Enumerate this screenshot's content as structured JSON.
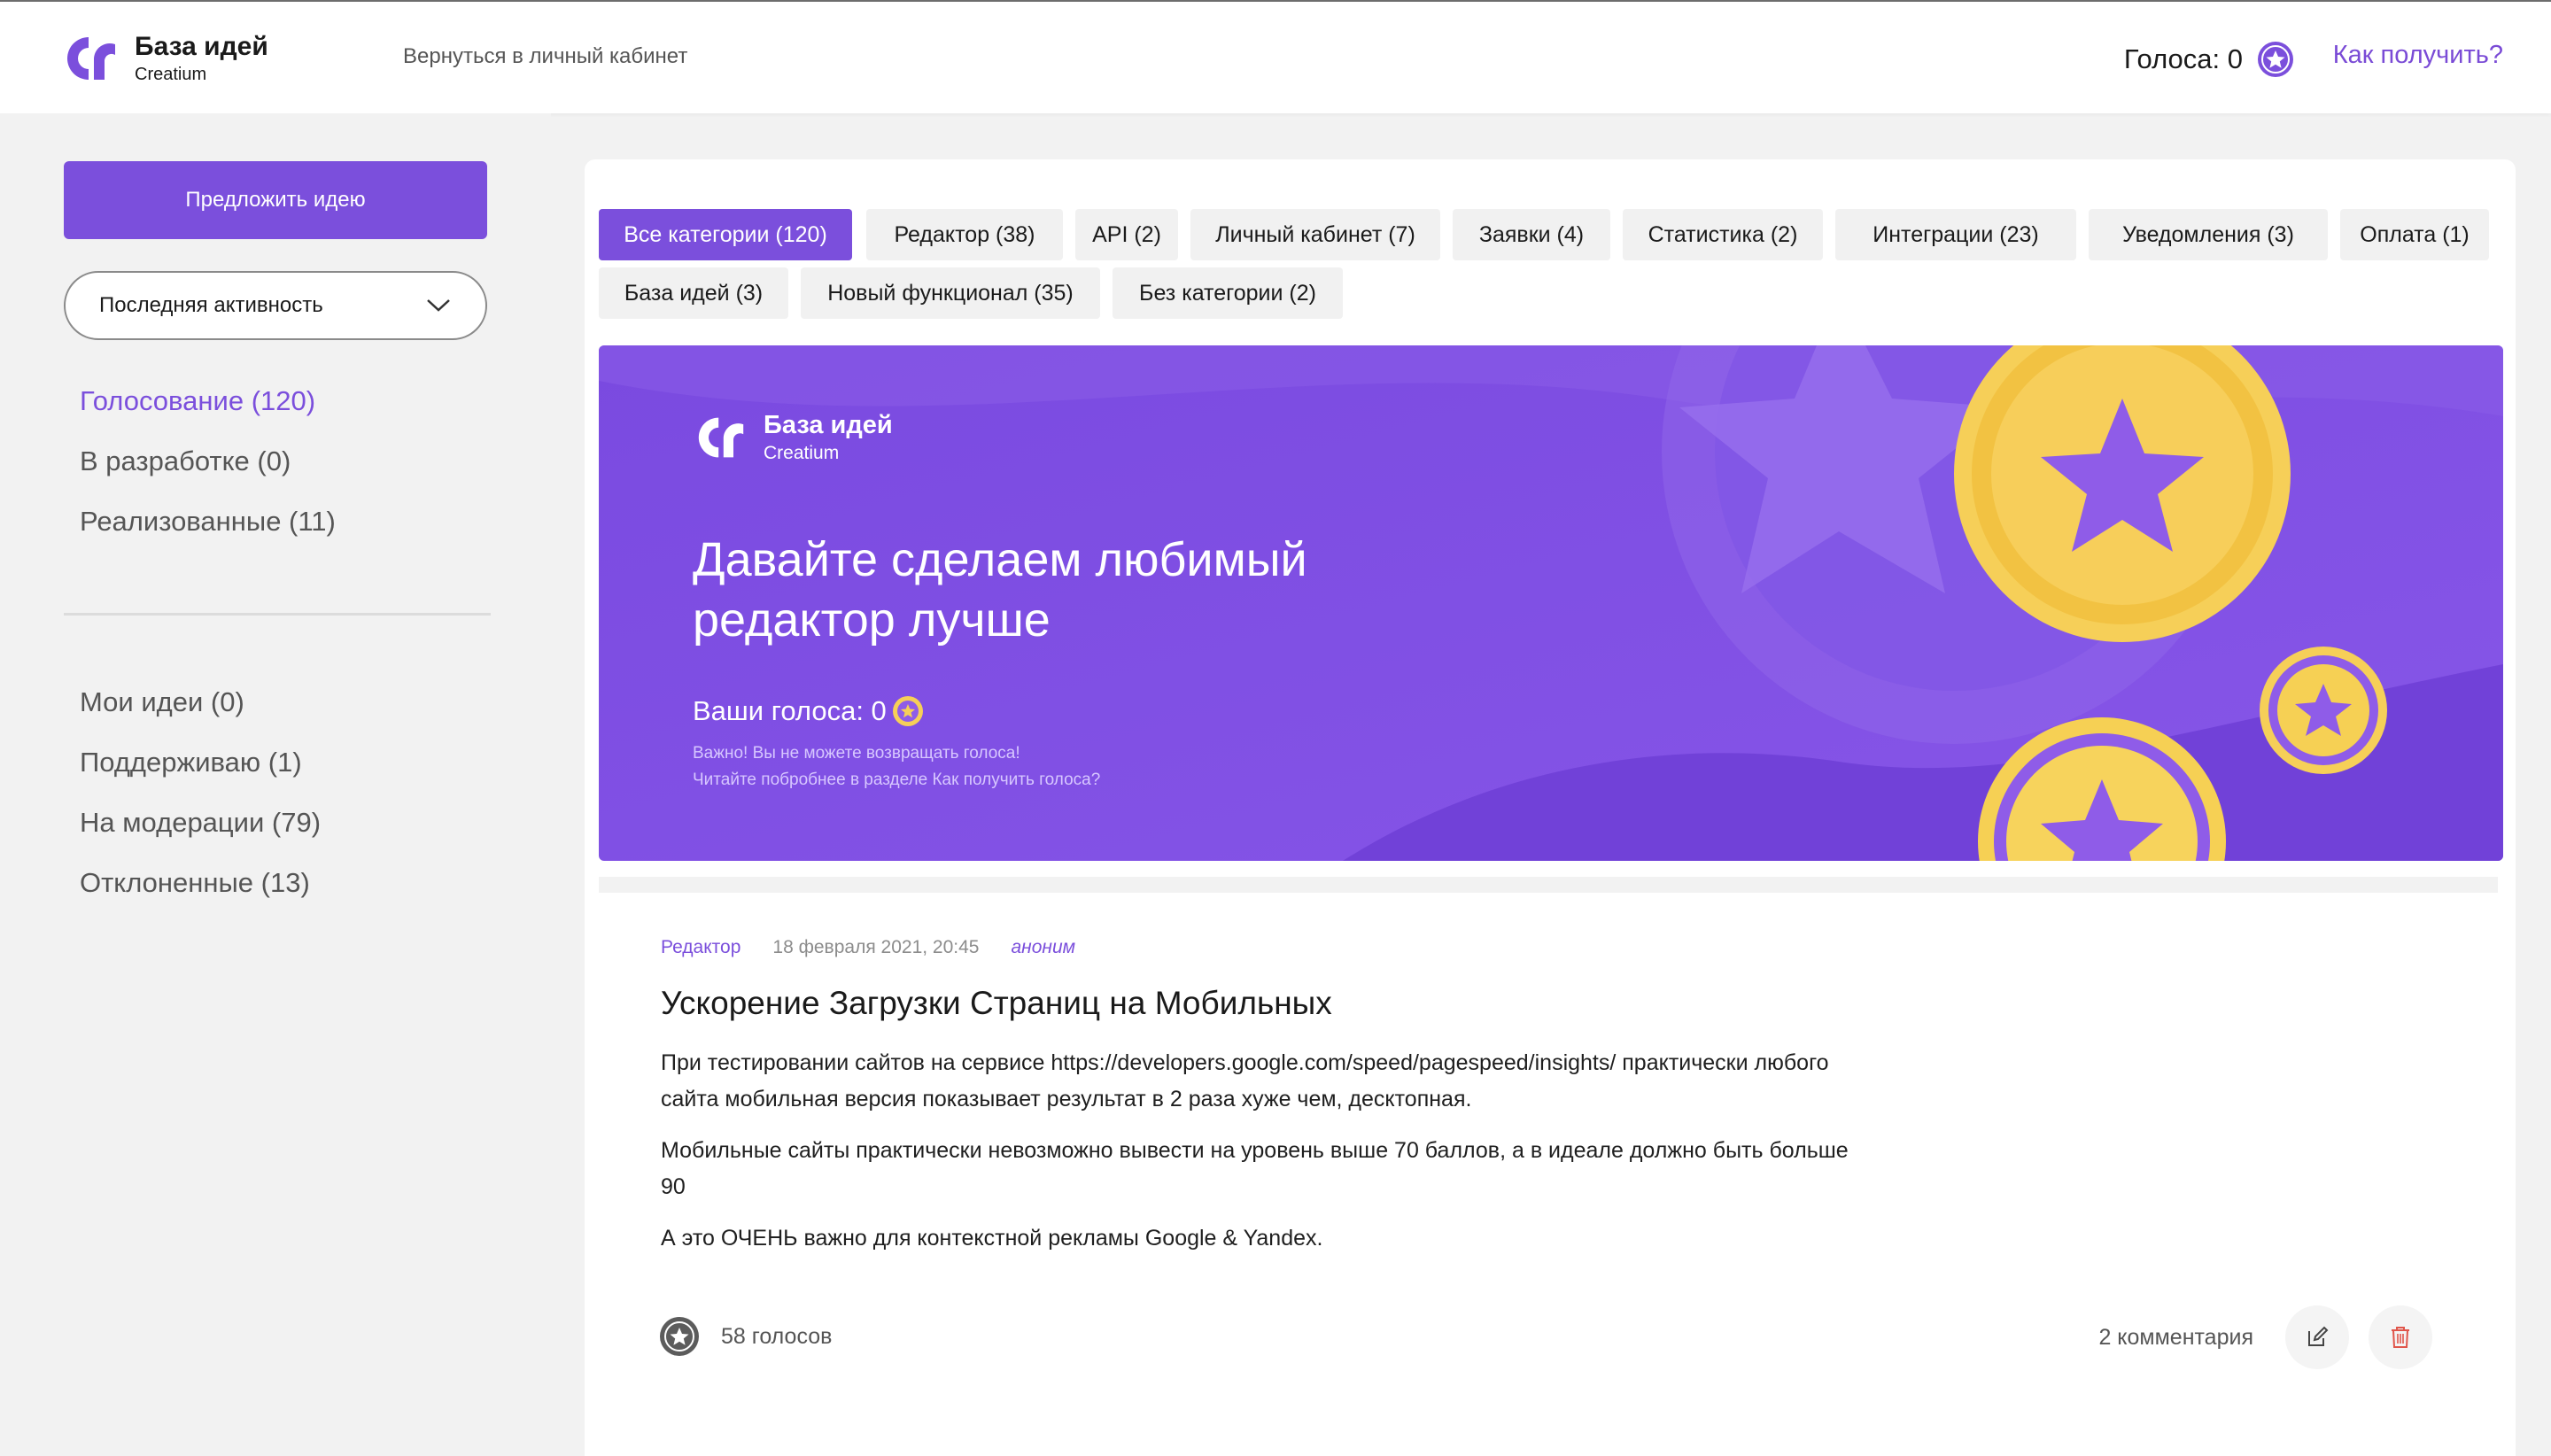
{
  "header": {
    "logo_title": "База идей",
    "logo_sub": "Creatium",
    "back_link": "Вернуться в личный кабинет",
    "votes_label": "Голоса: 0",
    "how_link": "Как получить?"
  },
  "sidebar": {
    "propose_button": "Предложить идею",
    "sort_select": "Последняя активность",
    "status_items": [
      {
        "label": "Голосование (120)",
        "active": true
      },
      {
        "label": "В разработке (0)"
      },
      {
        "label": "Реализованные (11)"
      }
    ],
    "my_items": [
      {
        "label": "Мои идеи (0)"
      },
      {
        "label": "Поддерживаю (1)"
      },
      {
        "label": "На модерации (79)"
      },
      {
        "label": "Отклоненные (13)"
      }
    ]
  },
  "categories": [
    {
      "label": "Все категории (120)",
      "active": true
    },
    {
      "label": "Редактор (38)"
    },
    {
      "label": "API (2)"
    },
    {
      "label": "Личный кабинет (7)"
    },
    {
      "label": "Заявки (4)"
    },
    {
      "label": "Статистика (2)"
    },
    {
      "label": "Интеграции (23)"
    },
    {
      "label": "Уведомления (3)"
    },
    {
      "label": "Оплата (1)"
    },
    {
      "label": "База идей (3)"
    },
    {
      "label": "Новый функционал (35)"
    },
    {
      "label": "Без категории (2)"
    }
  ],
  "banner": {
    "logo_title": "База идей",
    "logo_sub": "Creatium",
    "title_line1": "Давайте сделаем любимый",
    "title_line2": "редактор лучше",
    "votes": "Ваши голоса: 0",
    "note_line1": "Важно! Вы не можете возвращать голоса!",
    "note_line2": "Читайте побробнее в разделе Как получить голоса?"
  },
  "idea": {
    "category": "Редактор",
    "date": "18 февраля 2021, 20:45",
    "author": "аноним",
    "title": "Ускорение Загрузки Страниц на Мобильных",
    "paragraphs": [
      "При тестировании сайтов на сервисе https://developers.google.com/speed/pagespeed/insights/ практически любого сайта мобильная версия показывает результат в 2 раза хуже чем, десктопная.",
      "Мобильные сайты практически невозможно вывести на уровень выше 70 баллов, а в идеале должно быть больше 90",
      "А это ОЧЕНЬ важно для контекстной рекламы Google & Yandex."
    ],
    "votes": "58 голосов",
    "comments": "2 комментария"
  },
  "colors": {
    "accent": "#7b4fdc",
    "banner": "#7f52e0",
    "coin": "#f6cf58"
  }
}
